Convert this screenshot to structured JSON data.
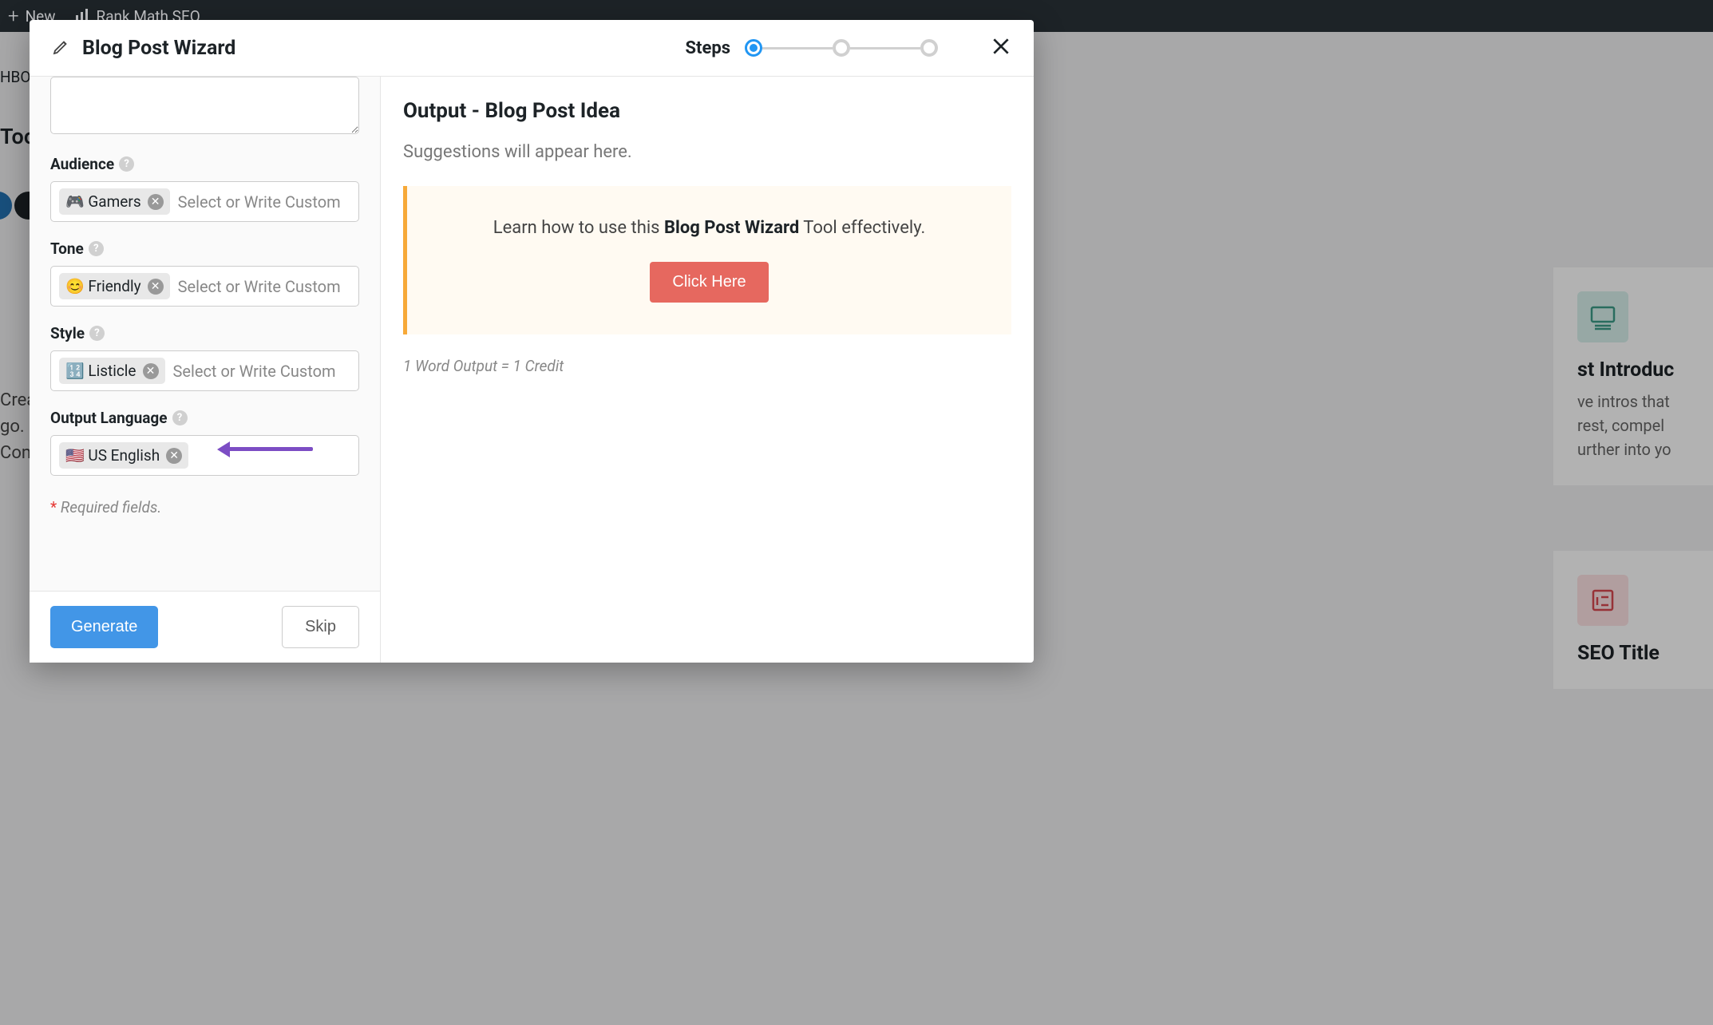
{
  "toolbar": {
    "new_label": "New",
    "seo_label": "Rank Math SEO"
  },
  "backdrop": {
    "dashboard_text": "HBOA",
    "tool_text": "Tool",
    "create_text": "Creat",
    "go_text": "go.",
    "cont_text": "Cont",
    "card1_title": "st Introduc",
    "card1_desc": "ve intros that rest, compel urther into yo",
    "card2_title": "SEO Title"
  },
  "modal": {
    "title": "Blog Post Wizard",
    "steps_label": "Steps"
  },
  "form": {
    "audience_label": "Audience",
    "audience_tag": "🎮 Gamers",
    "audience_placeholder": "Select or Write Custom",
    "tone_label": "Tone",
    "tone_tag": "😊 Friendly",
    "tone_placeholder": "Select or Write Custom",
    "style_label": "Style",
    "style_tag": "🔢 Listicle",
    "style_placeholder": "Select or Write Custom",
    "output_lang_label": "Output Language",
    "output_lang_tag": "🇺🇸 US English",
    "required_text": "Required fields.",
    "generate_btn": "Generate",
    "skip_btn": "Skip"
  },
  "output": {
    "heading": "Output - Blog Post Idea",
    "suggestions": "Suggestions will appear here.",
    "info_prefix": "Learn how to use this ",
    "info_bold": "Blog Post Wizard",
    "info_suffix": " Tool effectively.",
    "click_here": "Click Here",
    "credit_note": "1 Word Output = 1 Credit"
  }
}
